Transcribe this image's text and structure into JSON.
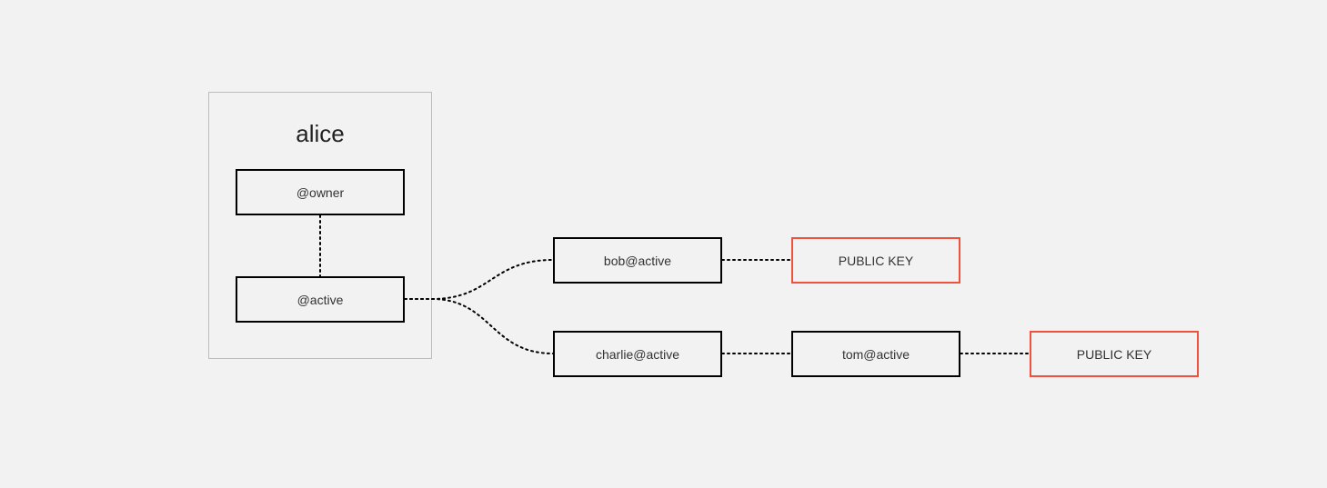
{
  "diagram": {
    "account": {
      "name": "alice",
      "permissions": {
        "owner": "@owner",
        "active": "@active"
      }
    },
    "delegates": {
      "bob": "bob@active",
      "charlie": "charlie@active",
      "tom": "tom@active"
    },
    "keys": {
      "key1": "PUBLIC KEY",
      "key2": "PUBLIC KEY"
    },
    "edges": [
      {
        "from": "owner",
        "to": "active"
      },
      {
        "from": "active",
        "to": "bob"
      },
      {
        "from": "active",
        "to": "charlie"
      },
      {
        "from": "bob",
        "to": "key1"
      },
      {
        "from": "charlie",
        "to": "tom"
      },
      {
        "from": "tom",
        "to": "key2"
      }
    ],
    "colors": {
      "page_bg": "#f2f2f2",
      "node_border": "#000000",
      "key_border": "#ef513c",
      "container_border": "#bdbdbd",
      "edge": "#000000"
    }
  }
}
